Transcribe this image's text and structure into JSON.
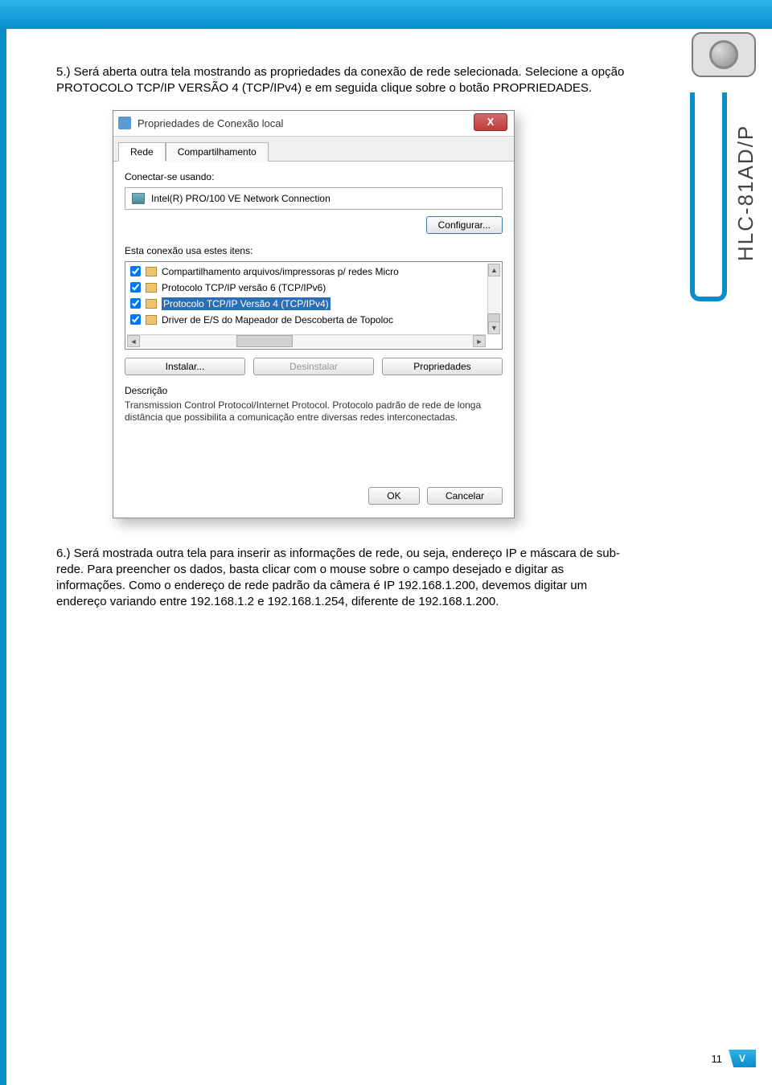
{
  "header": {
    "side_label": "HLC-81AD/P"
  },
  "text": {
    "para1": "5.)  Será aberta outra tela mostrando as propriedades da conexão de rede selecionada. Selecione a opção PROTOCOLO TCP/IP VERSÃO 4 (TCP/IPv4) e em seguida clique sobre o botão PROPRIEDADES.",
    "para2": "6.)  Será mostrada outra tela para inserir as informações de rede, ou seja, endereço IP e máscara de sub-rede. Para preencher os dados, basta clicar com o mouse sobre o campo desejado e digitar as informações. Como o endereço de rede padrão da câmera é IP  192.168.1.200, devemos digitar um endereço variando entre 192.168.1.2 e 192.168.1.254, diferente de 192.168.1.200."
  },
  "dialog": {
    "title": "Propriedades de Conexão local",
    "close_x": "X",
    "tabs": {
      "rede": "Rede",
      "compart": "Compartilhamento"
    },
    "connect_label": "Conectar-se usando:",
    "adapter": "Intel(R) PRO/100 VE Network Connection",
    "configure_btn": "Configurar...",
    "items_label": "Esta conexão usa estes itens:",
    "items": [
      {
        "checked": true,
        "label": "Compartilhamento arquivos/impressoras p/ redes Micro"
      },
      {
        "checked": true,
        "label": "Protocolo TCP/IP versão 6 (TCP/IPv6)"
      },
      {
        "checked": true,
        "label": "Protocolo TCP/IP Versão 4 (TCP/IPv4)",
        "selected": true
      },
      {
        "checked": true,
        "label": "Driver de E/S do Mapeador de Descoberta de Topoloc"
      }
    ],
    "install_btn": "Instalar...",
    "uninstall_btn": "Desinstalar",
    "props_btn": "Propriedades",
    "desc_label": "Descrição",
    "desc_text": "Transmission Control Protocol/Internet Protocol. Protocolo padrão de rede de longa distância que possibilita a comunicação entre diversas redes interconectadas.",
    "ok_btn": "OK",
    "cancel_btn": "Cancelar"
  },
  "footer": {
    "page_number": "11",
    "logo": "V"
  }
}
